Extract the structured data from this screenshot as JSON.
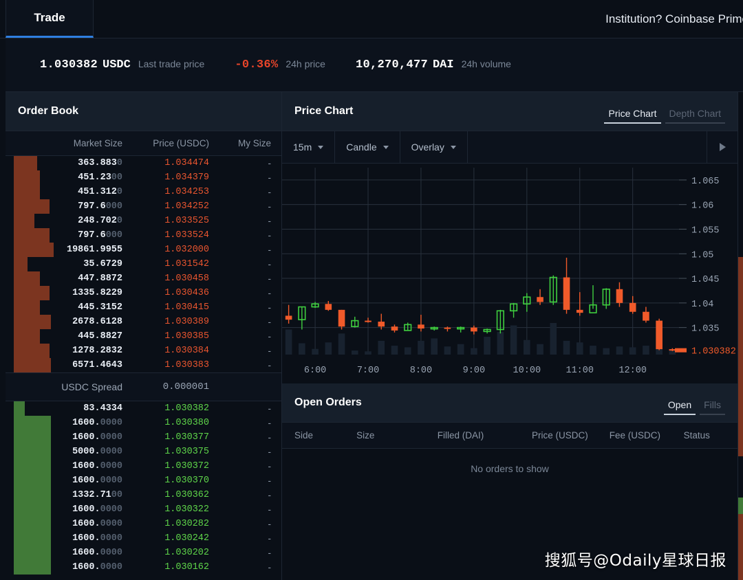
{
  "nav": {
    "tab_label": "Trade",
    "promo_text": "Institution? Coinbase Prime"
  },
  "stats": {
    "last_trade_price": "1.030382",
    "last_trade_unit": "USDC",
    "last_trade_label": "Last trade price",
    "change_24h": "-0.36%",
    "change_24h_label": "24h price",
    "volume_24h": "10,270,477",
    "volume_unit": "DAI",
    "volume_label": "24h volume"
  },
  "order_book": {
    "title": "Order Book",
    "columns": [
      "Market Size",
      "Price (USDC)",
      "My Size"
    ],
    "spread_label": "USDC Spread",
    "spread_value": "0.000001",
    "asks": [
      {
        "size": "363.883",
        "size_dim": "0",
        "price": "1.034474",
        "my": "-",
        "depth": 34
      },
      {
        "size": "451.23",
        "size_dim": "00",
        "price": "1.034379",
        "my": "-",
        "depth": 38
      },
      {
        "size": "451.312",
        "size_dim": "0",
        "price": "1.034253",
        "my": "-",
        "depth": 38
      },
      {
        "size": "797.6",
        "size_dim": "000",
        "price": "1.034252",
        "my": "-",
        "depth": 52
      },
      {
        "size": "248.702",
        "size_dim": "0",
        "price": "1.033525",
        "my": "-",
        "depth": 30
      },
      {
        "size": "797.6",
        "size_dim": "000",
        "price": "1.033524",
        "my": "-",
        "depth": 52
      },
      {
        "size": "19861.9955",
        "size_dim": "",
        "price": "1.032000",
        "my": "-",
        "depth": 58
      },
      {
        "size": "35.6729",
        "size_dim": "",
        "price": "1.031542",
        "my": "-",
        "depth": 20
      },
      {
        "size": "447.8872",
        "size_dim": "",
        "price": "1.030458",
        "my": "-",
        "depth": 38
      },
      {
        "size": "1335.8229",
        "size_dim": "",
        "price": "1.030436",
        "my": "-",
        "depth": 52
      },
      {
        "size": "445.3152",
        "size_dim": "",
        "price": "1.030415",
        "my": "-",
        "depth": 38
      },
      {
        "size": "2678.6128",
        "size_dim": "",
        "price": "1.030389",
        "my": "-",
        "depth": 54
      },
      {
        "size": "445.8827",
        "size_dim": "",
        "price": "1.030385",
        "my": "-",
        "depth": 38
      },
      {
        "size": "1278.2832",
        "size_dim": "",
        "price": "1.030384",
        "my": "-",
        "depth": 52
      },
      {
        "size": "6571.4643",
        "size_dim": "",
        "price": "1.030383",
        "my": "-",
        "depth": 54
      }
    ],
    "bids": [
      {
        "size": "83.4334",
        "size_dim": "",
        "price": "1.030382",
        "my": "-",
        "depth": 16
      },
      {
        "size": "1600.",
        "size_dim": "0000",
        "price": "1.030380",
        "my": "-",
        "depth": 54
      },
      {
        "size": "1600.",
        "size_dim": "0000",
        "price": "1.030377",
        "my": "-",
        "depth": 54
      },
      {
        "size": "5000.",
        "size_dim": "0000",
        "price": "1.030375",
        "my": "-",
        "depth": 54
      },
      {
        "size": "1600.",
        "size_dim": "0000",
        "price": "1.030372",
        "my": "-",
        "depth": 54
      },
      {
        "size": "1600.",
        "size_dim": "0000",
        "price": "1.030370",
        "my": "-",
        "depth": 54
      },
      {
        "size": "1332.71",
        "size_dim": "00",
        "price": "1.030362",
        "my": "-",
        "depth": 54
      },
      {
        "size": "1600.",
        "size_dim": "0000",
        "price": "1.030322",
        "my": "-",
        "depth": 54
      },
      {
        "size": "1600.",
        "size_dim": "0000",
        "price": "1.030282",
        "my": "-",
        "depth": 54
      },
      {
        "size": "1600.",
        "size_dim": "0000",
        "price": "1.030242",
        "my": "-",
        "depth": 54
      },
      {
        "size": "1600.",
        "size_dim": "0000",
        "price": "1.030202",
        "my": "-",
        "depth": 54
      },
      {
        "size": "1600.",
        "size_dim": "0000",
        "price": "1.030162",
        "my": "-",
        "depth": 54
      }
    ]
  },
  "price_chart": {
    "title": "Price Chart",
    "tabs": [
      {
        "label": "Price Chart",
        "active": true
      },
      {
        "label": "Depth Chart",
        "active": false
      }
    ],
    "toolbar": {
      "interval": "15m",
      "chart_type": "Candle",
      "overlay": "Overlay",
      "play_icon": "play-icon"
    }
  },
  "chart_data": {
    "type": "candlestick",
    "title": "Price Chart",
    "xlabel": "",
    "ylabel": "",
    "ylim": [
      1.0295,
      1.0675
    ],
    "yticks": [
      "1.065",
      "1.06",
      "1.055",
      "1.05",
      "1.045",
      "1.04",
      "1.035"
    ],
    "ytick_values": [
      1.065,
      1.06,
      1.055,
      1.05,
      1.045,
      1.04,
      1.035
    ],
    "xticks": [
      "6:00",
      "7:00",
      "8:00",
      "9:00",
      "10:00",
      "11:00",
      "12:00"
    ],
    "grid": true,
    "interval": "15m",
    "current_price": 1.030382,
    "current_price_label": "1.030382",
    "up_color": "#3fcf3f",
    "down_color": "#f05a2a",
    "volume_color": "#18222f",
    "candles": [
      {
        "o": 1.0374,
        "h": 1.0396,
        "l": 1.0358,
        "c": 1.0366,
        "v": 62
      },
      {
        "o": 1.0366,
        "h": 1.0392,
        "l": 1.0346,
        "c": 1.0392,
        "v": 28
      },
      {
        "o": 1.0392,
        "h": 1.0402,
        "l": 1.039,
        "c": 1.0398,
        "v": 14
      },
      {
        "o": 1.0398,
        "h": 1.0404,
        "l": 1.0384,
        "c": 1.0386,
        "v": 30
      },
      {
        "o": 1.0386,
        "h": 1.0386,
        "l": 1.0346,
        "c": 1.0352,
        "v": 52
      },
      {
        "o": 1.0352,
        "h": 1.0372,
        "l": 1.035,
        "c": 1.0364,
        "v": 10
      },
      {
        "o": 1.0364,
        "h": 1.037,
        "l": 1.036,
        "c": 1.0362,
        "v": 8
      },
      {
        "o": 1.0362,
        "h": 1.0378,
        "l": 1.0346,
        "c": 1.0352,
        "v": 34
      },
      {
        "o": 1.0352,
        "h": 1.0356,
        "l": 1.034,
        "c": 1.0344,
        "v": 22
      },
      {
        "o": 1.0344,
        "h": 1.036,
        "l": 1.0344,
        "c": 1.0356,
        "v": 18
      },
      {
        "o": 1.0356,
        "h": 1.0376,
        "l": 1.0342,
        "c": 1.0348,
        "v": 34
      },
      {
        "o": 1.0348,
        "h": 1.0352,
        "l": 1.0344,
        "c": 1.035,
        "v": 40
      },
      {
        "o": 1.035,
        "h": 1.0352,
        "l": 1.0342,
        "c": 1.0348,
        "v": 20
      },
      {
        "o": 1.0348,
        "h": 1.0352,
        "l": 1.034,
        "c": 1.035,
        "v": 26
      },
      {
        "o": 1.035,
        "h": 1.0354,
        "l": 1.0336,
        "c": 1.0342,
        "v": 16
      },
      {
        "o": 1.0342,
        "h": 1.0348,
        "l": 1.0338,
        "c": 1.0346,
        "v": 44
      },
      {
        "o": 1.0346,
        "h": 1.0386,
        "l": 1.0338,
        "c": 1.0384,
        "v": 56
      },
      {
        "o": 1.0384,
        "h": 1.04,
        "l": 1.037,
        "c": 1.0398,
        "v": 72
      },
      {
        "o": 1.0398,
        "h": 1.042,
        "l": 1.0382,
        "c": 1.0412,
        "v": 36
      },
      {
        "o": 1.0412,
        "h": 1.0428,
        "l": 1.0396,
        "c": 1.0402,
        "v": 26
      },
      {
        "o": 1.0402,
        "h": 1.0456,
        "l": 1.0396,
        "c": 1.0452,
        "v": 78
      },
      {
        "o": 1.0452,
        "h": 1.0492,
        "l": 1.0378,
        "c": 1.0386,
        "v": 34
      },
      {
        "o": 1.0386,
        "h": 1.0422,
        "l": 1.0374,
        "c": 1.038,
        "v": 30
      },
      {
        "o": 1.038,
        "h": 1.0436,
        "l": 1.0388,
        "c": 1.0396,
        "v": 22
      },
      {
        "o": 1.0396,
        "h": 1.043,
        "l": 1.0388,
        "c": 1.0428,
        "v": 16
      },
      {
        "o": 1.0428,
        "h": 1.0442,
        "l": 1.0392,
        "c": 1.04,
        "v": 20
      },
      {
        "o": 1.04,
        "h": 1.0414,
        "l": 1.0378,
        "c": 1.0382,
        "v": 18
      },
      {
        "o": 1.0382,
        "h": 1.0392,
        "l": 1.036,
        "c": 1.0364,
        "v": 22
      },
      {
        "o": 1.0364,
        "h": 1.0368,
        "l": 1.0304,
        "c": 1.0306,
        "v": 56
      },
      {
        "o": 1.0306,
        "h": 1.0308,
        "l": 1.0302,
        "c": 1.0304,
        "v": 12
      }
    ]
  },
  "open_orders": {
    "title": "Open Orders",
    "tabs": [
      {
        "label": "Open",
        "active": true
      },
      {
        "label": "Fills",
        "active": false
      }
    ],
    "columns": [
      "Side",
      "Size",
      "Filled (DAI)",
      "Price (USDC)",
      "Fee (USDC)",
      "Status"
    ],
    "empty_message": "No orders to show"
  },
  "watermark": "搜狐号@Odaily星球日报"
}
